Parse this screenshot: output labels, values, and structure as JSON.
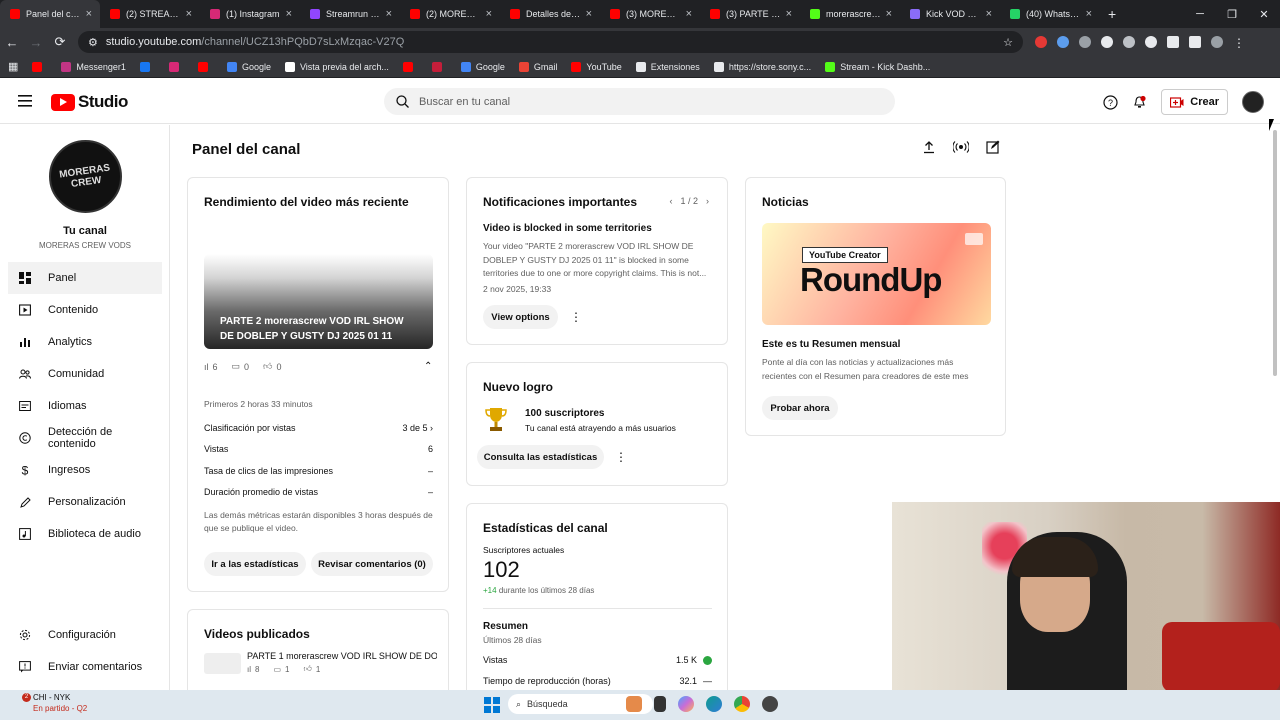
{
  "browser": {
    "tabs": [
      {
        "title": "Panel del canal",
        "color": "#ff0000"
      },
      {
        "title": "(2) STREAM VOD",
        "color": "#ff0000"
      },
      {
        "title": "(1) Instagram",
        "color": "#d62976"
      },
      {
        "title": "Streamrun Go",
        "color": "#9146ff"
      },
      {
        "title": "(2) MORERAS",
        "color": "#ff0000"
      },
      {
        "title": "Detalles del vid",
        "color": "#ff0000"
      },
      {
        "title": "(3) MORERAS",
        "color": "#ff0000"
      },
      {
        "title": "(3) PARTE 2 m",
        "color": "#ff0000"
      },
      {
        "title": "morerascrew C",
        "color": "#53fc18"
      },
      {
        "title": "Kick VOD Dow",
        "color": "#8a6cf7"
      },
      {
        "title": "(40) WhatsApp",
        "color": "#25d366"
      }
    ],
    "new_tab": "+",
    "url_host": "studio.youtube.com",
    "url_path": "/channel/UCZ13hPQbD7sLxMzqac-V27Q",
    "bookmarks": [
      {
        "label": "",
        "color": "#ff0000"
      },
      {
        "label": "Messenger1",
        "color": "#c13584"
      },
      {
        "label": "",
        "color": "#1877f2"
      },
      {
        "label": "",
        "color": "#d62976"
      },
      {
        "label": "",
        "color": "#ff0000"
      },
      {
        "label": "Google",
        "color": "#4285f4"
      },
      {
        "label": "Vista previa del arch...",
        "color": "#ffffff"
      },
      {
        "label": "",
        "color": "#ff0000"
      },
      {
        "label": "",
        "color": "#c41e3a"
      },
      {
        "label": "Google",
        "color": "#4285f4"
      },
      {
        "label": "Gmail",
        "color": "#ea4335"
      },
      {
        "label": "YouTube",
        "color": "#ff0000"
      },
      {
        "label": "Extensiones",
        "color": "#e8eaed"
      },
      {
        "label": "https://store.sony.c...",
        "color": "#e8eaed"
      },
      {
        "label": "Stream - Kick Dashb...",
        "color": "#53fc18"
      }
    ]
  },
  "header": {
    "logo_text": "Studio",
    "search_placeholder": "Buscar en tu canal",
    "create_label": "Crear"
  },
  "sidebar": {
    "channel_title": "Tu canal",
    "channel_name": "MORERAS CREW VODS",
    "avatar_text": "MORERAS CREW",
    "items": [
      {
        "label": "Panel",
        "icon": "dashboard-icon",
        "active": true
      },
      {
        "label": "Contenido",
        "icon": "content-icon"
      },
      {
        "label": "Analytics",
        "icon": "analytics-icon"
      },
      {
        "label": "Comunidad",
        "icon": "community-icon"
      },
      {
        "label": "Idiomas",
        "icon": "subtitles-icon"
      },
      {
        "label": "Detección de contenido",
        "icon": "copyright-icon"
      },
      {
        "label": "Ingresos",
        "icon": "dollar-icon"
      },
      {
        "label": "Personalización",
        "icon": "customization-icon"
      },
      {
        "label": "Biblioteca de audio",
        "icon": "audio-library-icon"
      }
    ],
    "bottom": [
      {
        "label": "Configuración",
        "icon": "gear-icon"
      },
      {
        "label": "Enviar comentarios",
        "icon": "feedback-icon"
      }
    ]
  },
  "main": {
    "title": "Panel del canal",
    "latest_video": {
      "title": "Rendimiento del video más reciente",
      "video_title": "PARTE 2 morerascrew VOD IRL SHOW DE DOBLEP Y GUSTY DJ 2025 01 11",
      "views": "6",
      "comments": "0",
      "likes": "0",
      "period": "Primeros 2 horas 33 minutos",
      "metrics": [
        {
          "label": "Clasificación por vistas",
          "value": "3 de 5 ›"
        },
        {
          "label": "Vistas",
          "value": "6"
        },
        {
          "label": "Tasa de clics de las impresiones",
          "value": "–"
        },
        {
          "label": "Duración promedio de vistas",
          "value": "–"
        }
      ],
      "note": "Las demás métricas estarán disponibles 3 horas después de que se publique el video.",
      "btn_stats": "Ir a las estadísticas",
      "btn_comments": "Revisar comentarios (0)"
    },
    "published": {
      "title": "Videos publicados",
      "item_title": "PARTE 1 morerascrew VOD IRL SHOW DE DOB...",
      "views": "8",
      "comments": "1",
      "likes": "1"
    },
    "notifications": {
      "title": "Notificaciones importantes",
      "pager": "1 / 2",
      "headline": "Video is blocked in some territories",
      "body": "Your video \"PARTE 2 morerascrew VOD IRL SHOW DE DOBLEP Y GUSTY DJ 2025 01 11\" is blocked in some territories due to one or more copyright claims. This is not...",
      "date": "2 nov 2025, 19:33",
      "button": "View options"
    },
    "achievement": {
      "title": "Nuevo logro",
      "headline": "100 suscriptores",
      "body": "Tu canal está atrayendo a más usuarios",
      "button": "Consulta las estadísticas"
    },
    "channel_stats": {
      "title": "Estadísticas del canal",
      "subs_label": "Suscriptores actuales",
      "subs_value": "102",
      "subs_delta": "+14",
      "subs_delta_label": "durante los últimos 28 días",
      "summary_title": "Resumen",
      "summary_period": "Últimos 28 días",
      "rows": [
        {
          "label": "Vistas",
          "value": "1.5 K"
        },
        {
          "label": "Tiempo de reproducción (horas)",
          "value": "32.1"
        }
      ]
    },
    "news": {
      "title": "Noticias",
      "banner_tag": "YouTube Creator",
      "banner_big": "RoundUp",
      "headline": "Este es tu Resumen mensual",
      "body": "Ponte al día con las noticias y actualizaciones más recientes con el Resumen para creadores de este mes",
      "button": "Probar ahora"
    }
  },
  "taskbar": {
    "weather_l1": "CHI - NYK",
    "weather_l2": "En partido - Q2",
    "badge": "2",
    "search": "Búsqueda"
  }
}
